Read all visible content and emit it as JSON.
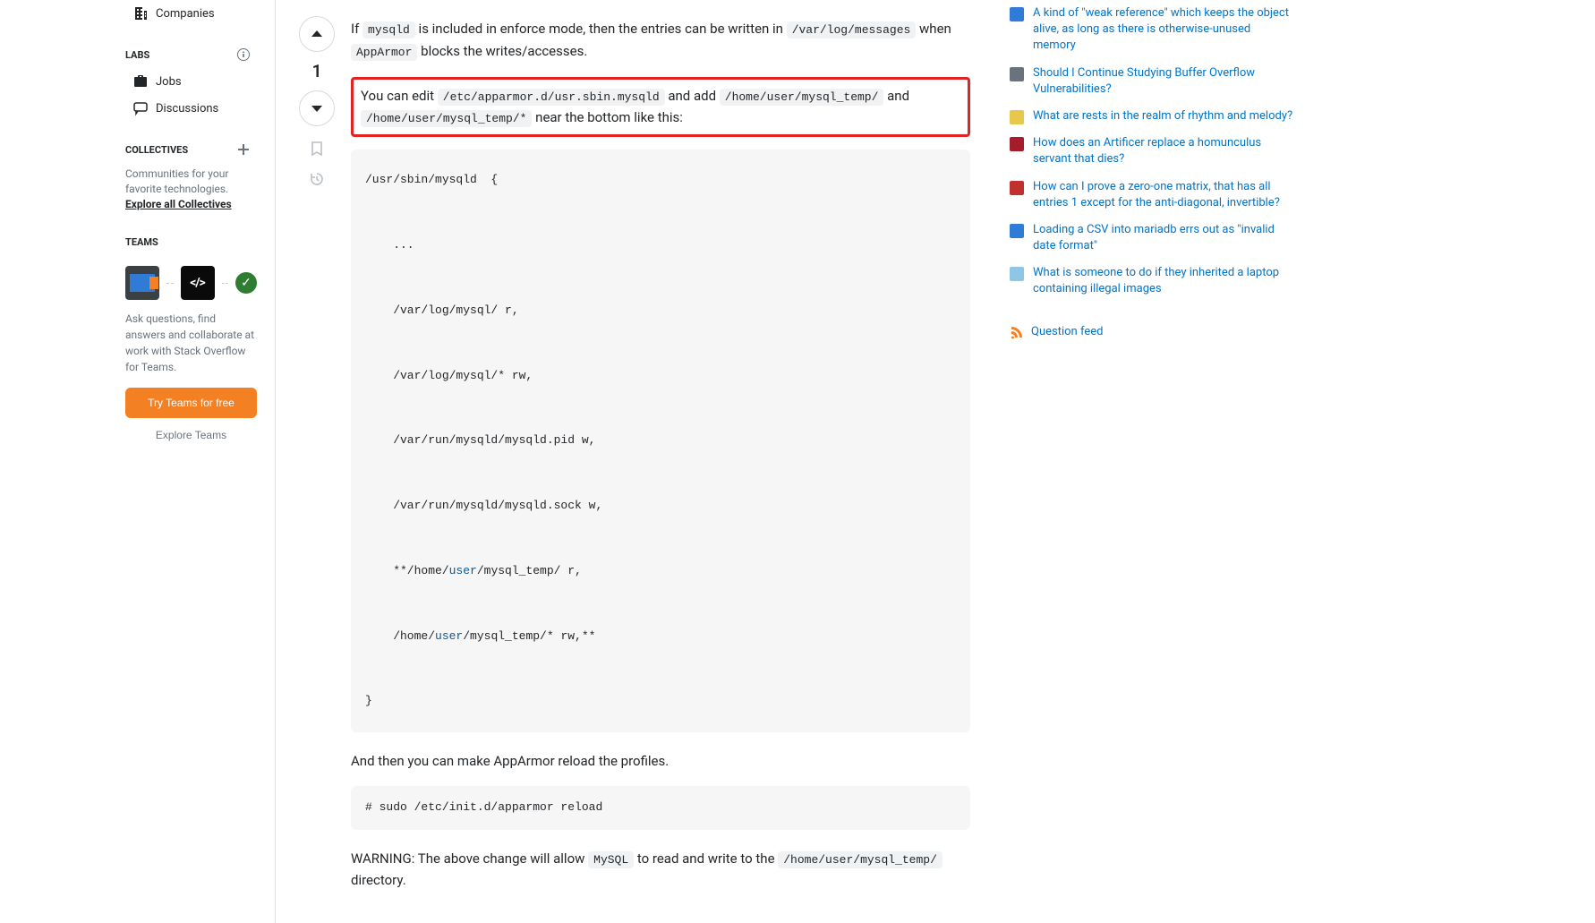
{
  "sidebar": {
    "companies_label": "Companies",
    "labs_title": "LABS",
    "jobs_label": "Jobs",
    "discussions_label": "Discussions",
    "collectives_title": "COLLECTIVES",
    "collectives_desc_prefix": "Communities for your favorite technologies. ",
    "collectives_link": "Explore all Collectives",
    "teams_title": "TEAMS",
    "teams_desc": "Ask questions, find answers and collaborate at work with Stack Overflow for Teams.",
    "try_teams_btn": "Try Teams for free",
    "explore_teams_btn": "Explore Teams"
  },
  "vote": {
    "count": "1"
  },
  "answer": {
    "p1_a": "If ",
    "p1_code1": "mysqld",
    "p1_b": " is included in enforce mode, then the entries can be written in ",
    "p1_code2": "/var/log/messages",
    "p1_c": " when ",
    "p1_code3": "AppArmor",
    "p1_d": " blocks the writes/accesses.",
    "p2_a": "You can edit ",
    "p2_code1": "/etc/apparmor.d/usr.sbin.mysqld",
    "p2_b": " and add ",
    "p2_code2": "/home/user/mysql_temp/",
    "p2_c": " and ",
    "p2_code3": "/home/user/mysql_temp/*",
    "p2_d": " near the bottom like this:",
    "codeblock": {
      "line1": "/usr/sbin/mysqld  {",
      "line2": "    ...",
      "line3": "    /var/log/mysql/ r,",
      "line4": "    /var/log/mysql/* rw,",
      "line5": "    /var/run/mysqld/mysqld.pid w,",
      "line6": "    /var/run/mysqld/mysqld.sock w,",
      "line7a": "    **/home/",
      "line7kw": "user",
      "line7b": "/mysql_temp/ r,",
      "line8a": "    /home/",
      "line8kw": "user",
      "line8b": "/mysql_temp/* rw,**",
      "line9": "}"
    },
    "p3": "And then you can make AppArmor reload the profiles.",
    "cmdblock": "# sudo /etc/init.d/apparmor reload",
    "p4_a": "WARNING: The above change will allow ",
    "p4_code1": "MySQL",
    "p4_b": " to read and write to the ",
    "p4_code2": "/home/user/mysql_temp/",
    "p4_c": " directory."
  },
  "hot": {
    "items": [
      {
        "color": "#2f7bd6",
        "text": "A kind of \"weak reference\" which keeps the object alive, as long as there is otherwise-unused memory"
      },
      {
        "color": "#6a737c",
        "text": "Should I Continue Studying Buffer Overflow Vulnerabilities?"
      },
      {
        "color": "#e6c84c",
        "text": "What are rests in the realm of rhythm and melody?"
      },
      {
        "color": "#a51d2a",
        "text": "How does an Artificer replace a homunculus servant that dies?"
      },
      {
        "color": "#c13030",
        "text": "How can I prove a zero-one matrix, that has all entries 1 except for the anti-diagonal, invertible?"
      },
      {
        "color": "#2f7bd6",
        "text": "Loading a CSV into mariadb errs out as \"invalid date format\""
      },
      {
        "color": "#8ec7e6",
        "text": "What is someone to do if they inherited a laptop containing illegal images"
      }
    ],
    "feed_label": "Question feed"
  }
}
